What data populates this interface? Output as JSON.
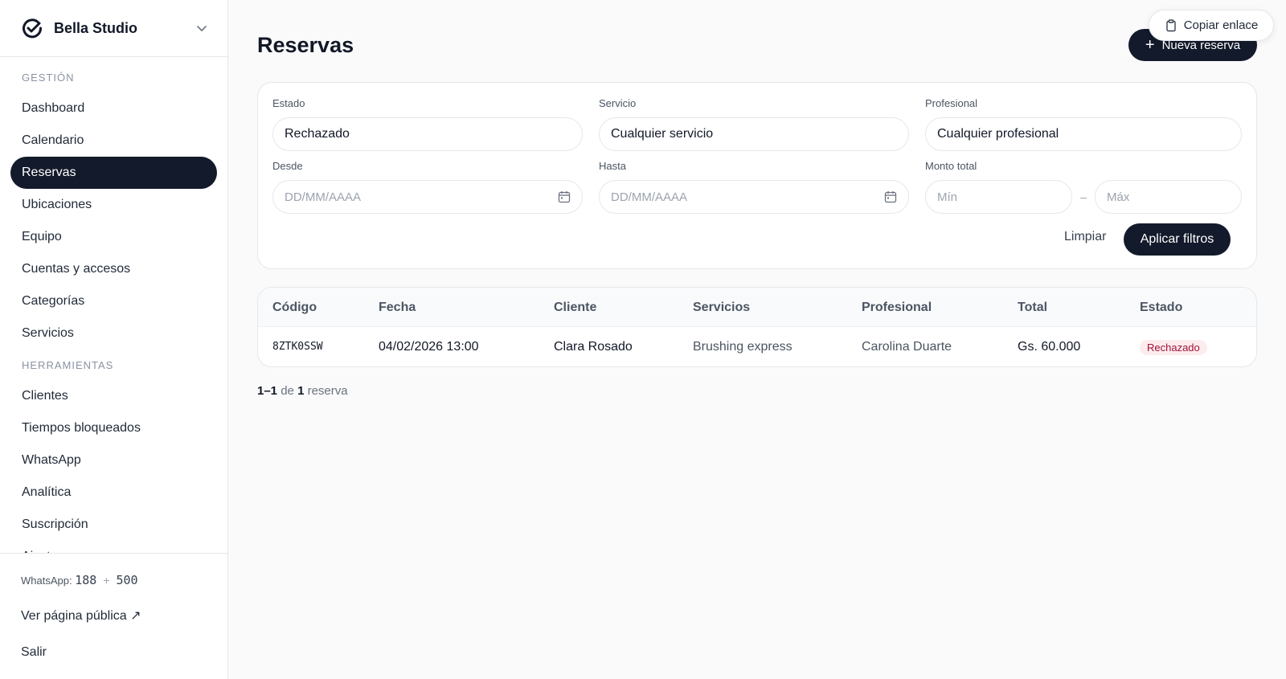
{
  "brand": {
    "name": "Bella Studio"
  },
  "sidebar": {
    "sections": [
      {
        "title": "GESTIÓN",
        "items": [
          "Dashboard",
          "Calendario",
          "Reservas",
          "Ubicaciones",
          "Equipo",
          "Cuentas y accesos",
          "Categorías",
          "Servicios"
        ]
      },
      {
        "title": "HERRAMIENTAS",
        "items": [
          "Clientes",
          "Tiempos bloqueados",
          "WhatsApp",
          "Analítica",
          "Suscripción",
          "Ajustes"
        ]
      }
    ],
    "active_item": "Reservas",
    "footer": {
      "whatsapp_label": "WhatsApp:",
      "whatsapp_used": "188",
      "whatsapp_plus": "+",
      "whatsapp_extra": "500",
      "public_page": "Ver página pública ↗",
      "logout": "Salir"
    }
  },
  "header": {
    "title": "Reservas",
    "new_button": "Nueva reserva",
    "copy_link": "Copiar enlace"
  },
  "filters": {
    "estado": {
      "label": "Estado",
      "value": "Rechazado"
    },
    "servicio": {
      "label": "Servicio",
      "value": "Cualquier servicio"
    },
    "profesional": {
      "label": "Profesional",
      "value": "Cualquier profesional"
    },
    "desde": {
      "label": "Desde",
      "placeholder": "DD/MM/AAAA"
    },
    "hasta": {
      "label": "Hasta",
      "placeholder": "DD/MM/AAAA"
    },
    "monto": {
      "label": "Monto total",
      "min_placeholder": "Mín",
      "separator": "–",
      "max_placeholder": "Máx"
    },
    "clear": "Limpiar",
    "apply": "Aplicar filtros"
  },
  "table": {
    "columns": [
      "Código",
      "Fecha",
      "Cliente",
      "Servicios",
      "Profesional",
      "Total",
      "Estado"
    ],
    "rows": [
      {
        "codigo": "8ZTK0SSW",
        "fecha": "04/02/2026 13:00",
        "cliente": "Clara Rosado",
        "servicios": "Brushing express",
        "profesional": "Carolina Duarte",
        "total": "Gs. 60.000",
        "estado": "Rechazado"
      }
    ]
  },
  "pagination": {
    "range": "1–1",
    "of": "de",
    "total": "1",
    "unit": "reserva"
  },
  "colors": {
    "primary": "#131a2b",
    "badge_bg": "#fdecee",
    "badge_text": "#9f1239"
  }
}
